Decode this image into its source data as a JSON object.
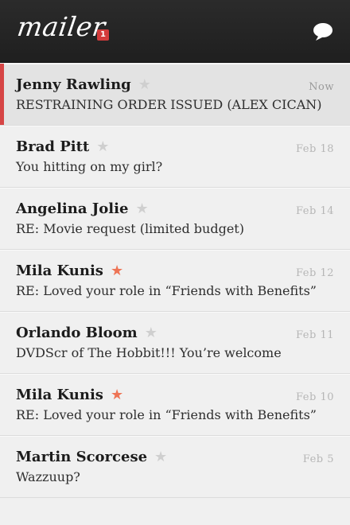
{
  "app": {
    "title": "mailer",
    "unread_count": "1"
  },
  "header": {
    "compose_icon": "speech-bubble-icon"
  },
  "colors": {
    "accent": "#d64545",
    "badge": "#d43b3b",
    "star_on": "#ee7455",
    "star_off": "#cfcfcf",
    "header_bg": "#252525"
  },
  "messages": [
    {
      "sender": "Jenny Rawling",
      "subject": "RESTRAINING ORDER ISSUED (ALEX CICAN)",
      "date": "Now",
      "starred": false,
      "selected": true
    },
    {
      "sender": "Brad Pitt",
      "subject": "You hitting on my girl?",
      "date": "Feb 18",
      "starred": false,
      "selected": false
    },
    {
      "sender": "Angelina Jolie",
      "subject": "RE: Movie request (limited budget)",
      "date": "Feb 14",
      "starred": false,
      "selected": false
    },
    {
      "sender": "Mila Kunis",
      "subject": "RE: Loved your role in “Friends with Benefits”",
      "date": "Feb 12",
      "starred": true,
      "selected": false
    },
    {
      "sender": "Orlando Bloom",
      "subject": "DVDScr of The Hobbit!!! You’re welcome",
      "date": "Feb 11",
      "starred": false,
      "selected": false
    },
    {
      "sender": "Mila Kunis",
      "subject": "RE: Loved your role in “Friends with Benefits”",
      "date": "Feb 10",
      "starred": true,
      "selected": false
    },
    {
      "sender": "Martin Scorcese",
      "subject": "Wazzuup?",
      "date": "Feb 5",
      "starred": false,
      "selected": false
    }
  ]
}
